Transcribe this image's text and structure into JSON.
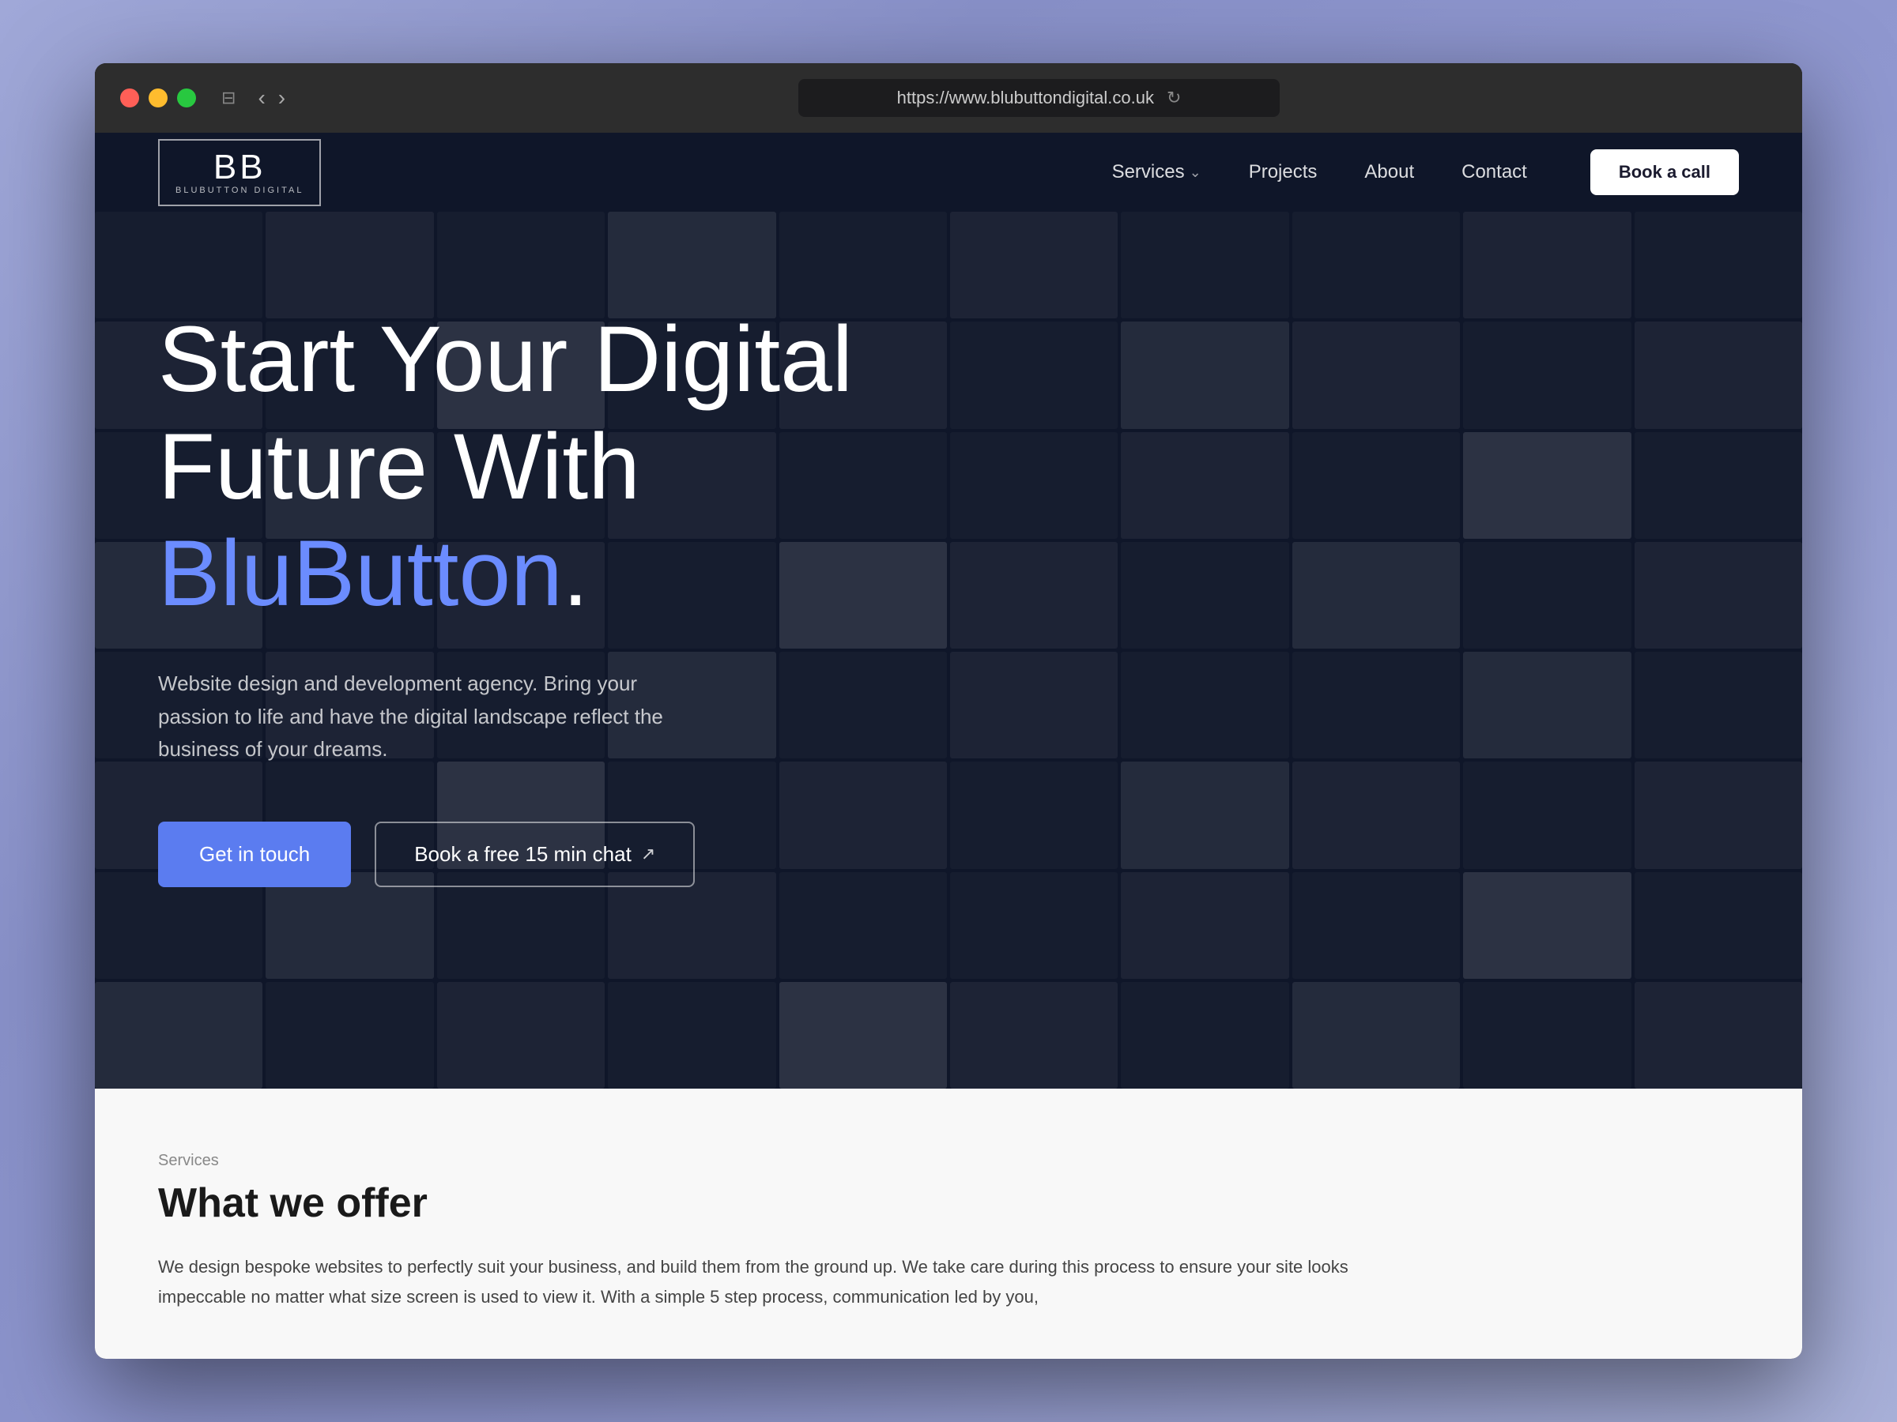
{
  "browser": {
    "url": "https://www.blubuttondigital.co.uk",
    "back_icon": "‹",
    "forward_icon": "›",
    "sidebar_icon": "⊞",
    "reload_icon": "↻"
  },
  "nav": {
    "logo_letters": "BB",
    "logo_text": "BLUBUTTON DIGITAL",
    "links": [
      {
        "label": "Services",
        "has_dropdown": true
      },
      {
        "label": "Projects"
      },
      {
        "label": "About"
      },
      {
        "label": "Contact"
      }
    ],
    "cta_label": "Book a call"
  },
  "hero": {
    "title_line1": "Start Your Digital",
    "title_line2_normal": "Future With ",
    "title_line2_blue": "BluButton",
    "title_period": ".",
    "subtitle": "Website design and development agency. Bring your passion to life and have the digital landscape reflect the business of your dreams.",
    "btn_primary": "Get in touch",
    "btn_secondary": "Book a free 15 min chat"
  },
  "services": {
    "section_label": "Services",
    "section_title": "What we offer",
    "description": "We design bespoke websites to perfectly suit your business, and build them from the ground up. We take care during this process to ensure your site looks impeccable no matter what size screen is used to view it. With a simple 5 step process, communication led by you,"
  },
  "grid": {
    "cells": [
      "dark",
      "medium",
      "dark",
      "light",
      "dark",
      "medium",
      "dark",
      "dark",
      "medium",
      "dark",
      "medium",
      "dark",
      "lighter",
      "dark",
      "medium",
      "dark",
      "light",
      "medium",
      "dark",
      "medium",
      "dark",
      "light",
      "dark",
      "medium",
      "dark",
      "dark",
      "medium",
      "dark",
      "lighter",
      "dark",
      "light",
      "dark",
      "medium",
      "dark",
      "lighter",
      "medium",
      "dark",
      "light",
      "dark",
      "medium",
      "dark",
      "medium",
      "dark",
      "light",
      "dark",
      "medium",
      "dark",
      "dark",
      "light",
      "dark",
      "medium",
      "dark",
      "lighter",
      "dark",
      "medium",
      "dark",
      "light",
      "medium",
      "dark",
      "medium",
      "dark",
      "light",
      "dark",
      "medium",
      "dark",
      "dark",
      "medium",
      "dark",
      "lighter",
      "dark",
      "light",
      "dark",
      "medium",
      "dark",
      "lighter",
      "medium",
      "dark",
      "light",
      "dark",
      "medium"
    ]
  }
}
